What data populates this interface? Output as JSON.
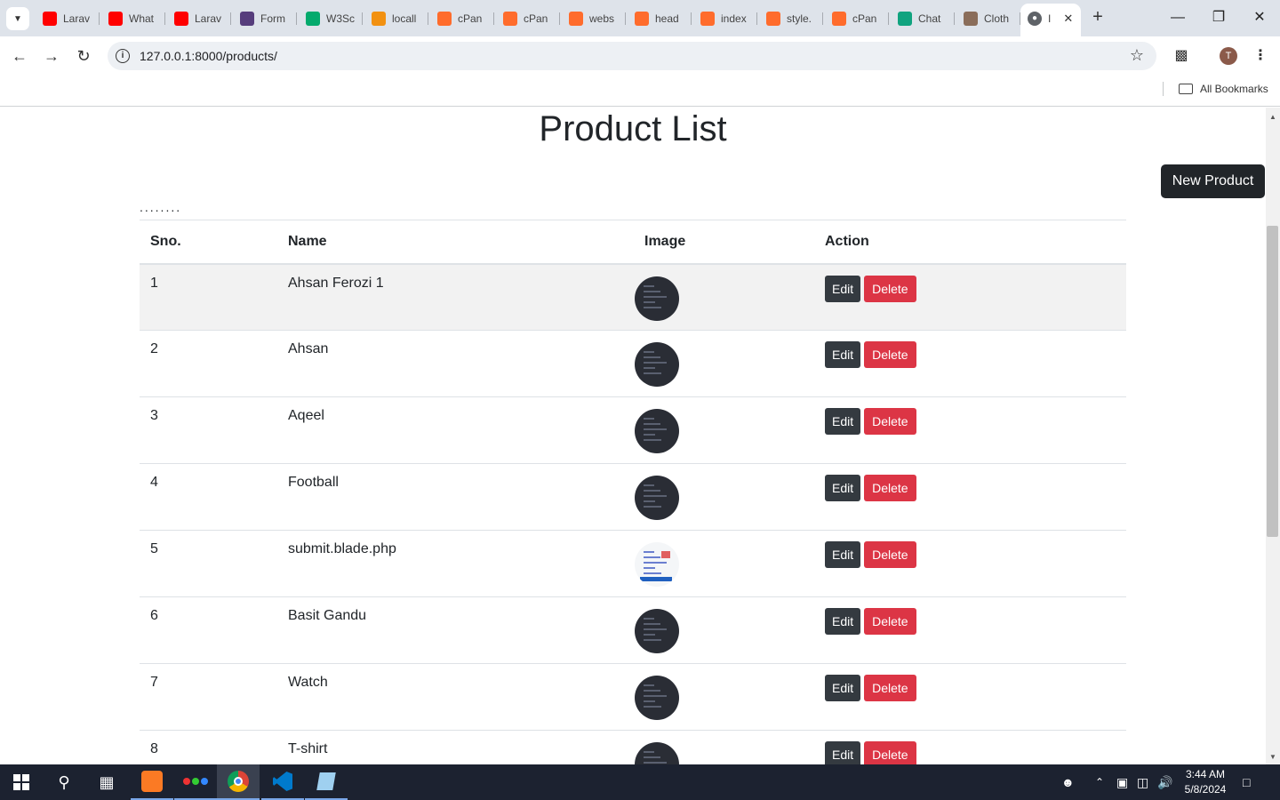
{
  "browser": {
    "tabs": [
      {
        "label": "Larav",
        "icon": "youtube-icon",
        "color": "#ff0000"
      },
      {
        "label": "What",
        "icon": "youtube-icon",
        "color": "#ff0000"
      },
      {
        "label": "Larav",
        "icon": "youtube-icon",
        "color": "#ff0000"
      },
      {
        "label": "Form",
        "icon": "bootstrap-icon",
        "color": "#563d7c"
      },
      {
        "label": "W3Sc",
        "icon": "w3schools-icon",
        "color": "#04aa6d"
      },
      {
        "label": "locall",
        "icon": "phpmyadmin-icon",
        "color": "#f29111"
      },
      {
        "label": "cPan",
        "icon": "cpanel-icon",
        "color": "#ff6c2c"
      },
      {
        "label": "cPan",
        "icon": "cpanel-icon",
        "color": "#ff6c2c"
      },
      {
        "label": "webs",
        "icon": "cpanel-icon",
        "color": "#ff6c2c"
      },
      {
        "label": "head",
        "icon": "cpanel-icon",
        "color": "#ff6c2c"
      },
      {
        "label": "index",
        "icon": "cpanel-icon",
        "color": "#ff6c2c"
      },
      {
        "label": "style.",
        "icon": "cpanel-icon",
        "color": "#ff6c2c"
      },
      {
        "label": "cPan",
        "icon": "cpanel-icon",
        "color": "#ff6c2c"
      },
      {
        "label": "Chat",
        "icon": "chatgpt-icon",
        "color": "#10a37f"
      },
      {
        "label": "Cloth",
        "icon": "site-icon",
        "color": "#8a6d5a"
      }
    ],
    "active_tab_label": "I",
    "url": "127.0.0.1:8000/products/",
    "bookmarks_folder": "All Bookmarks",
    "profile_initial": "T"
  },
  "page": {
    "title": "Product List",
    "new_button": "New Product",
    "dots": "........",
    "columns": [
      "Sno.",
      "Name",
      "Image",
      "Action"
    ],
    "edit_label": "Edit",
    "delete_label": "Delete",
    "rows": [
      {
        "sno": "1",
        "name": "Ahsan Ferozi 1",
        "image": "dark"
      },
      {
        "sno": "2",
        "name": "Ahsan",
        "image": "dark"
      },
      {
        "sno": "3",
        "name": "Aqeel",
        "image": "dark"
      },
      {
        "sno": "4",
        "name": "Football",
        "image": "dark"
      },
      {
        "sno": "5",
        "name": "submit.blade.php",
        "image": "light"
      },
      {
        "sno": "6",
        "name": "Basit Gandu",
        "image": "dark"
      },
      {
        "sno": "7",
        "name": "Watch",
        "image": "dark"
      },
      {
        "sno": "8",
        "name": "T-shirt",
        "image": "dark"
      }
    ]
  },
  "taskbar": {
    "time": "3:44 AM",
    "date": "5/8/2024"
  }
}
